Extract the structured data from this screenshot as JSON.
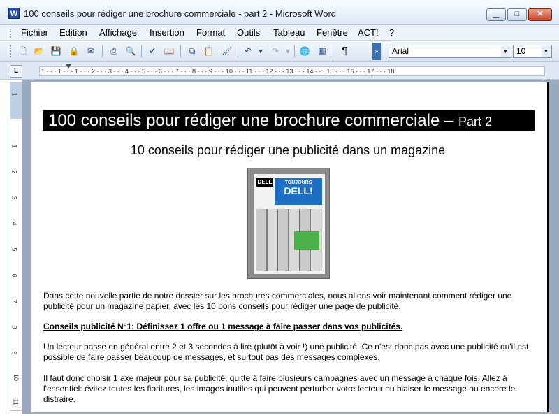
{
  "window": {
    "title": "100 conseils pour rédiger une brochure commerciale - part 2 - Microsoft Word",
    "icon": "W",
    "min_label": "▁",
    "max_label": "□",
    "close_label": "✕"
  },
  "menu": [
    "Fichier",
    "Edition",
    "Affichage",
    "Insertion",
    "Format",
    "Outils",
    "Tableau",
    "Fenêtre",
    "ACT!",
    "?"
  ],
  "toolbar": {
    "font_name": "Arial",
    "font_size": "10",
    "paragraph_mark": "¶"
  },
  "ruler": {
    "corner": "L",
    "horizontal": "1 · · · 1 · · · 1 · · · 2 · · · 3 · · · 4 · · · 5 · · · 6 · · · 7 · · · 8 · · · 9 · · · 10 · · · 11 · · · 12 · · · 13 · · · 14 · · · 15 · · · 16 · · · 17 · · · 18",
    "vertical": [
      "1",
      "1",
      "2",
      "3",
      "4",
      "5",
      "6",
      "7",
      "8",
      "9",
      "10",
      "11"
    ]
  },
  "document": {
    "heading": "100 conseils pour rédiger une brochure commerciale – ",
    "heading_small": "Part 2",
    "subheading": "10 conseils pour rédiger une publicité dans un magazine",
    "ad_image": {
      "logo": "DELL",
      "banner_top": "TOUJOURS",
      "banner_big": "DELL!"
    },
    "paragraphs": [
      "Dans cette nouvelle partie de notre dossier sur les brochures commerciales, nous allons voir maintenant comment rédiger une publicité pour un magazine papier, avec les 10 bons conseils pour rédiger une page de publicité.",
      "Conseils publicité N°1: Définissez 1 offre ou 1 message à faire passer dans vos publicités.",
      "Un lecteur passe en général entre 2 et 3 secondes à lire (plutôt à voir !) une publicité. Ce n'est donc pas avec une publicité qu'il est possible de faire passer beaucoup de messages, et surtout pas des messages complexes.",
      "Il faut donc choisir 1 axe majeur pour sa publicité, quitte à faire plusieurs campagnes avec un message à chaque fois. Allez à l'essentiel: évitez toutes les fioritures, les images inutiles qui peuvent perturber votre lecteur ou biaiser le message ou encore le distraire."
    ]
  }
}
